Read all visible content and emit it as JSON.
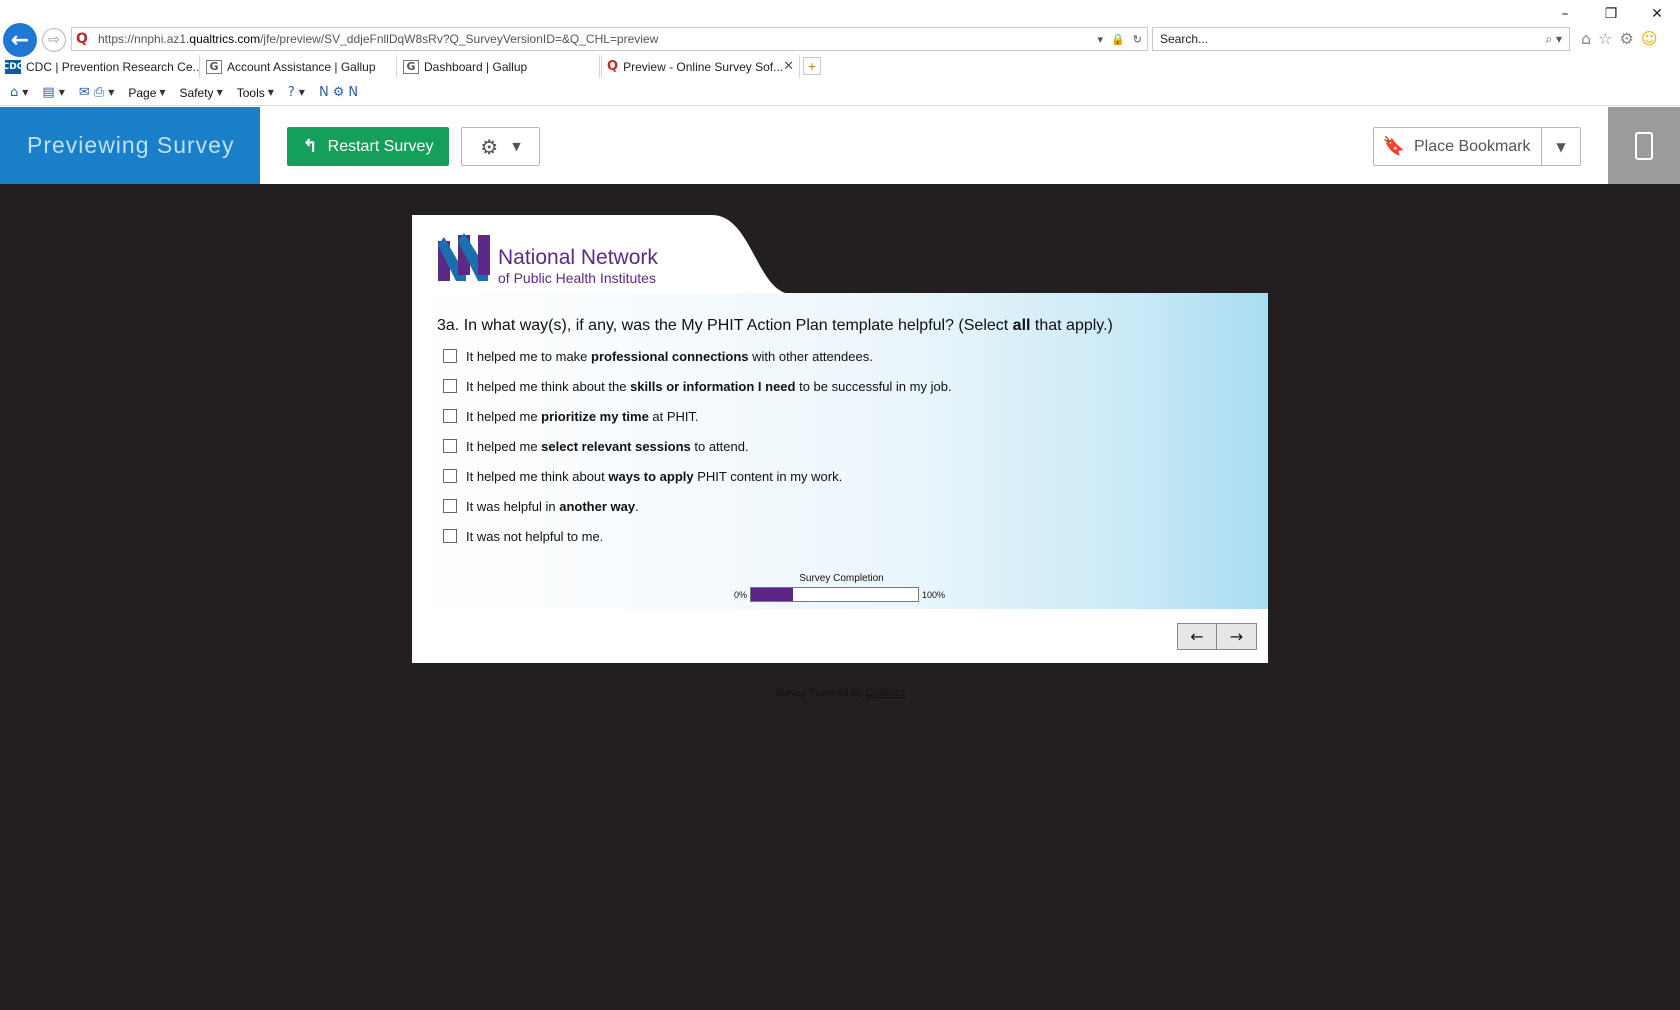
{
  "browser": {
    "url_prefix": "https://nnphi.az1.",
    "url_domain": "qualtrics.com",
    "url_path": "/jfe/preview/SV_ddjeFnllDqW8sRv?Q_SurveyVersionID=&Q_CHL=preview",
    "search_placeholder": "Search...",
    "tabs": [
      {
        "label": "CDC | Prevention Research Ce..."
      },
      {
        "label": "Account Assistance | Gallup"
      },
      {
        "label": "Dashboard | Gallup"
      },
      {
        "label": "Preview - Online Survey Sof..."
      }
    ],
    "menus": {
      "page": "Page",
      "safety": "Safety",
      "tools": "Tools"
    }
  },
  "preview": {
    "title": "Previewing Survey",
    "restart_label": "Restart Survey",
    "bookmark_label": "Place Bookmark"
  },
  "survey": {
    "logo_line1": "National Network",
    "logo_line2": "of Public Health Institutes",
    "question_prefix": "3a. In what way(s), if any, was the My PHIT Action Plan template helpful? (Select ",
    "question_bold": "all",
    "question_suffix": " that apply.)",
    "choices": [
      {
        "pre": "It helped me to make ",
        "bold": "professional connections",
        "post": " with other attendees."
      },
      {
        "pre": "It helped me think about the ",
        "bold": "skills or information I need",
        "post": " to be successful in my job."
      },
      {
        "pre": "It helped me ",
        "bold": "prioritize my time",
        "post": " at PHIT."
      },
      {
        "pre": "It helped me ",
        "bold": "select relevant sessions",
        "post": " to attend."
      },
      {
        "pre": "It helped me think about ",
        "bold": "ways to apply",
        "post": " PHIT content in my work."
      },
      {
        "pre": "It was helpful in ",
        "bold": "another way",
        "post": "."
      },
      {
        "pre": "It was not helpful to me.",
        "bold": "",
        "post": ""
      }
    ],
    "progress": {
      "title": "Survey Completion",
      "min_label": "0%",
      "max_label": "100%",
      "value_percent": 25
    },
    "powered_by": "Survey Powered By ",
    "powered_link": "Qualtrics"
  },
  "colors": {
    "accent_blue": "#1a7fc9",
    "restart_green": "#14a05a",
    "progress_purple": "#5e2483",
    "logo_purple": "#5b2a86"
  }
}
